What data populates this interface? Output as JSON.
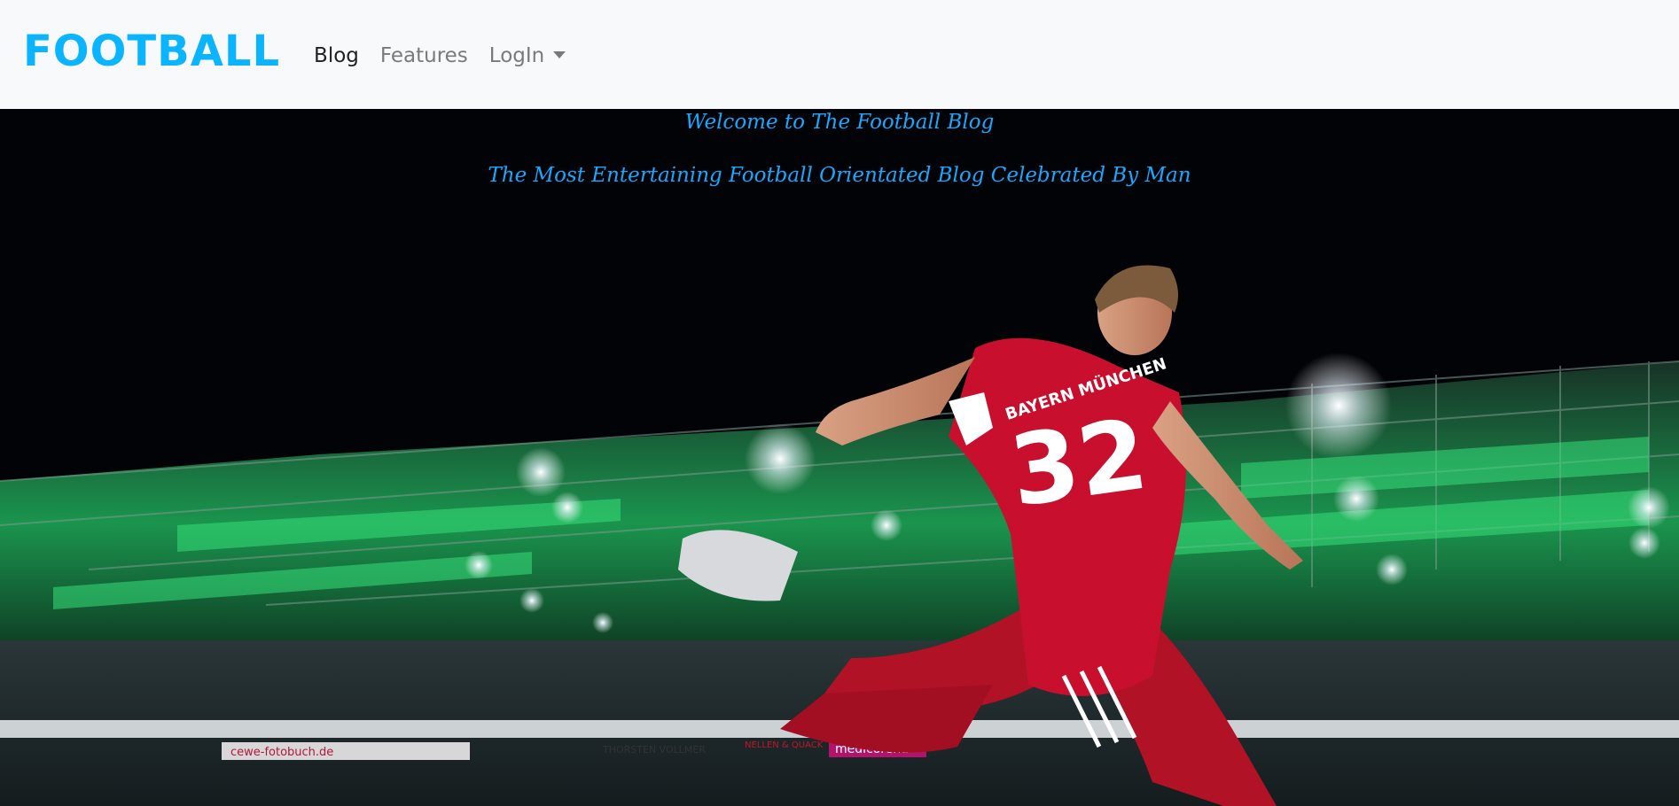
{
  "nav": {
    "brand": "FOOTBALL",
    "links": [
      {
        "label": "Blog",
        "active": true
      },
      {
        "label": "Features",
        "active": false
      },
      {
        "label": "LogIn",
        "active": false,
        "dropdown": true
      }
    ]
  },
  "hero": {
    "welcome": "Welcome to The Football Blog",
    "tagline": "The Most Entertaining Football Orientated Blog Celebrated By Man",
    "image": {
      "subject": "footballer kicking in stadium",
      "jersey_number": "32",
      "jersey_text": "BAYERN MÜNCHEN",
      "board_texts": [
        "cewe-fotobuch.de",
        "medicoreha",
        "THORSTEN VOLLMER",
        "NELLEN & QUACK"
      ]
    }
  },
  "colors": {
    "accent": "#0ab4ff",
    "nav_bg": "#f8f9fa",
    "hero_text": "#1aa8ff",
    "jersey": "#c8102e"
  }
}
